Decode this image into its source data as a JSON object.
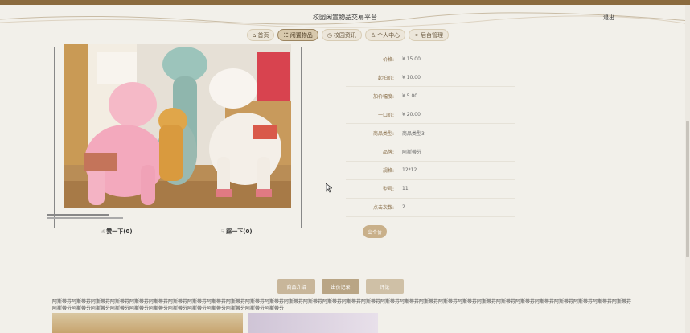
{
  "header": {
    "title": "校园闲置物品交易平台",
    "logout": "退出"
  },
  "nav": [
    {
      "icon": "home-icon",
      "glyph": "⌂",
      "label": "首页"
    },
    {
      "icon": "goods-icon",
      "glyph": "☷",
      "label": "闲置物品"
    },
    {
      "icon": "news-icon",
      "glyph": "◷",
      "label": "校园资讯"
    },
    {
      "icon": "user-icon",
      "glyph": "♙",
      "label": "个人中心"
    },
    {
      "icon": "link-icon",
      "glyph": "⚭",
      "label": "后台管理"
    }
  ],
  "rating": {
    "like": "赞一下(0)",
    "dislike": "踩一下(0)"
  },
  "attributes": [
    {
      "label": "价格:",
      "value": "¥ 15.00"
    },
    {
      "label": "起拍价:",
      "value": "¥ 10.00"
    },
    {
      "label": "加价幅度:",
      "value": "¥ 5.00"
    },
    {
      "label": "一口价:",
      "value": "¥ 20.00"
    },
    {
      "label": "商品类型:",
      "value": "商品类型3"
    },
    {
      "label": "品牌:",
      "value": "阿斯蒂芬"
    },
    {
      "label": "规格:",
      "value": "12*12"
    },
    {
      "label": "型号:",
      "value": "11"
    },
    {
      "label": "点击次数:",
      "value": "2"
    }
  ],
  "bid_button": "出个价",
  "tabs": [
    "商品介绍",
    "出价记录",
    "评论"
  ],
  "description": "阿斯蒂芬阿斯蒂芬阿斯蒂芬阿斯蒂芬阿斯蒂芬阿斯蒂芬阿斯蒂芬阿斯蒂芬阿斯蒂芬阿斯蒂芬阿斯蒂芬阿斯蒂芬阿斯蒂芬阿斯蒂芬阿斯蒂芬阿斯蒂芬阿斯蒂芬阿斯蒂芬阿斯蒂芬阿斯蒂芬阿斯蒂芬阿斯蒂芬阿斯蒂芬阿斯蒂芬阿斯蒂芬阿斯蒂芬阿斯蒂芬阿斯蒂芬阿斯蒂芬阿斯蒂芬阿斯蒂芬阿斯蒂芬阿斯蒂芬阿斯蒂芬阿斯蒂芬阿斯蒂芬阿斯蒂芬阿斯蒂芬阿斯蒂芬阿斯蒂芬阿斯蒂芬阿斯蒂芬",
  "colors": {
    "accent": "#8b6b3f",
    "button": "#c8b69a",
    "background": "#f2f0ea"
  }
}
